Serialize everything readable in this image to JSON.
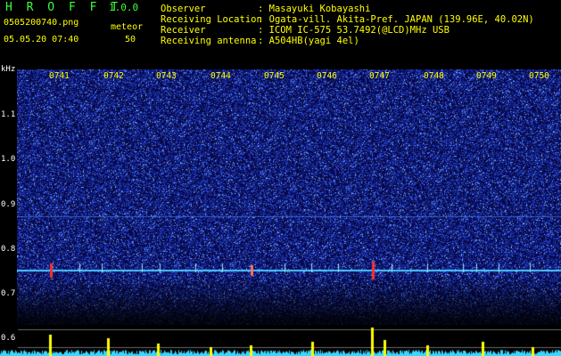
{
  "header": {
    "app_title": "H R O F F T",
    "app_version": "1.0.0",
    "file_name": "0505200740.png",
    "mode_label": "meteor",
    "date_time": "05.05.20 07:40",
    "count_value": "50"
  },
  "station": {
    "observer_label": "Observer",
    "observer_value": ": Masayuki Kobayashi",
    "location_label": "Receiving Location",
    "location_value": ": Ogata-vill. Akita-Pref. JAPAN (139.96E, 40.02N)",
    "receiver_label": "Receiver",
    "receiver_value": ": ICOM IC-575 53.7492(@LCD)MHz USB",
    "antenna_label": "Receiving antenna",
    "antenna_value": ": A504HB(yagi 4el)"
  },
  "axis": {
    "unit": "kHz",
    "y_labels": [
      "1.1",
      "1.0",
      "0.9",
      "0.8",
      "0.7",
      "0.6"
    ],
    "x_labels": [
      "0741",
      "0742",
      "0743",
      "0744",
      "0745",
      "0746",
      "0747",
      "0748",
      "0749",
      "0750"
    ]
  },
  "colors": {
    "background": "#000000",
    "text_yellow": "#ffff00",
    "text_green": "#3cff3c",
    "noise_dark": "#0a0a5a",
    "noise_blue": "#1e3cff",
    "carrier": "#4cc8ff",
    "echo_red": "#ff3030",
    "count_bar": "#ffff00",
    "noise_floor": "#39d8ff"
  }
}
